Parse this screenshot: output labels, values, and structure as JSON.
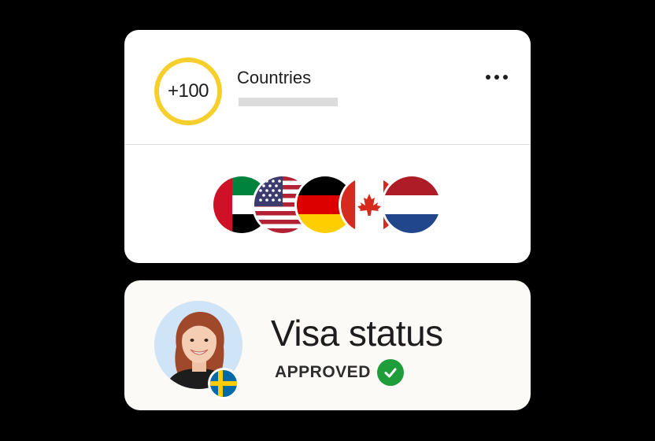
{
  "countries_card": {
    "count": "+100",
    "title": "Countries",
    "more_icon": "more-horizontal-icon",
    "flags": [
      "uae-flag-icon",
      "usa-flag-icon",
      "germany-flag-icon",
      "canada-flag-icon",
      "netherlands-flag-icon"
    ]
  },
  "visa_card": {
    "title": "Visa status",
    "status": "APPROVED",
    "status_icon": "check-circle-icon",
    "badge_flag": "sweden-flag-icon"
  },
  "colors": {
    "ring": "#f7cf2c",
    "approved": "#1f9d3b",
    "background": "#000000",
    "card_top": "#ffffff",
    "card_bottom": "#fbfaf6"
  }
}
